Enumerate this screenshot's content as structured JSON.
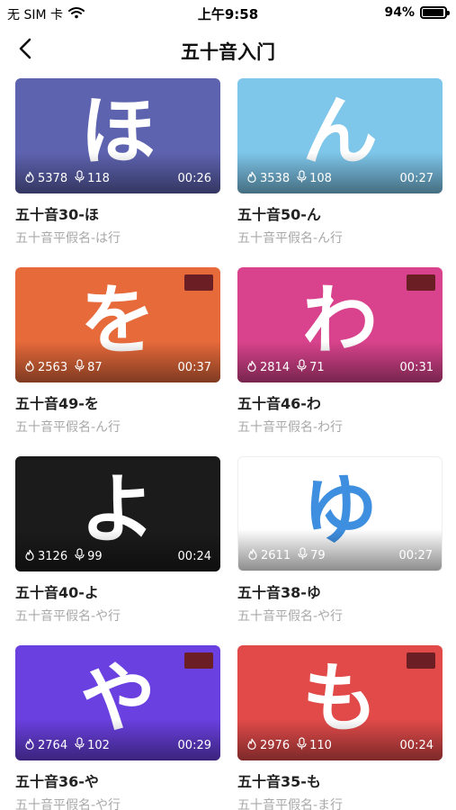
{
  "status_bar": {
    "carrier": "无 SIM 卡",
    "time": "上午9:58",
    "battery_percent": "94%",
    "battery_level": 0.94
  },
  "nav": {
    "title": "五十音入门",
    "back_icon": "chevron-left-icon"
  },
  "cards": [
    {
      "char": "ほ",
      "bg": "#5e63b0",
      "plays": "5378",
      "comments": "118",
      "duration": "00:26",
      "title": "五十音30-ほ",
      "subtitle": "五十音平假名-は行",
      "badge": false,
      "char_color": "#ffffff"
    },
    {
      "char": "ん",
      "bg": "#7ec6ea",
      "plays": "3538",
      "comments": "108",
      "duration": "00:27",
      "title": "五十音50-ん",
      "subtitle": "五十音平假名-ん行",
      "badge": false,
      "char_color": "#ffffff"
    },
    {
      "char": "を",
      "bg": "#e76a3b",
      "plays": "2563",
      "comments": "87",
      "duration": "00:37",
      "title": "五十音49-を",
      "subtitle": "五十音平假名-ん行",
      "badge": true,
      "char_color": "#ffffff"
    },
    {
      "char": "わ",
      "bg": "#d9438d",
      "plays": "2814",
      "comments": "71",
      "duration": "00:31",
      "title": "五十音46-わ",
      "subtitle": "五十音平假名-わ行",
      "badge": true,
      "char_color": "#ffffff"
    },
    {
      "char": "よ",
      "bg": "#1b1b1b",
      "plays": "3126",
      "comments": "99",
      "duration": "00:24",
      "title": "五十音40-よ",
      "subtitle": "五十音平假名-や行",
      "badge": false,
      "char_color": "#ffffff"
    },
    {
      "char": "ゆ",
      "bg": "#ffffff",
      "plays": "2611",
      "comments": "79",
      "duration": "00:27",
      "title": "五十音38-ゆ",
      "subtitle": "五十音平假名-や行",
      "badge": false,
      "char_color": "#3f8fe0"
    },
    {
      "char": "や",
      "bg": "#6a40e0",
      "plays": "2764",
      "comments": "102",
      "duration": "00:29",
      "title": "五十音36-や",
      "subtitle": "五十音平假名-や行",
      "badge": true,
      "char_color": "#ffffff"
    },
    {
      "char": "も",
      "bg": "#e24a4a",
      "plays": "2976",
      "comments": "110",
      "duration": "00:24",
      "title": "五十音35-も",
      "subtitle": "五十音平假名-ま行",
      "badge": true,
      "char_color": "#ffffff"
    }
  ],
  "icons": {
    "plays": "flame-icon",
    "comments": "microphone-icon"
  }
}
